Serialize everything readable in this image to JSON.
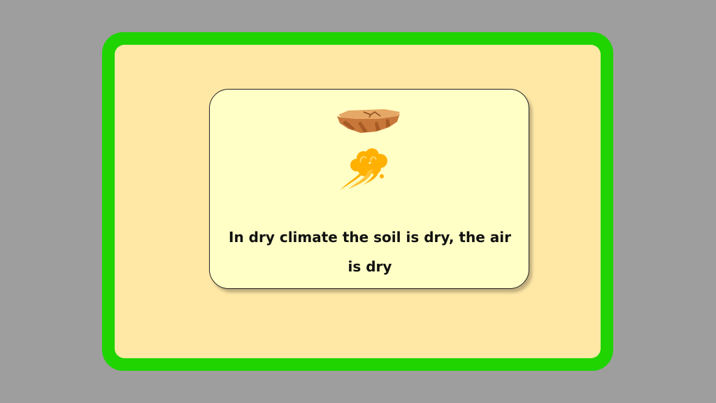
{
  "card": {
    "caption": "In dry climate the soil is dry, the air is dry",
    "icons": [
      "dry-soil-icon",
      "dry-air-icon"
    ]
  },
  "colors": {
    "background": "#9e9e9e",
    "frame": "#1fd400",
    "panel": "#ffe8a6",
    "card": "#ffffc6",
    "soil": "#d9894a",
    "air": "#ffb000"
  }
}
